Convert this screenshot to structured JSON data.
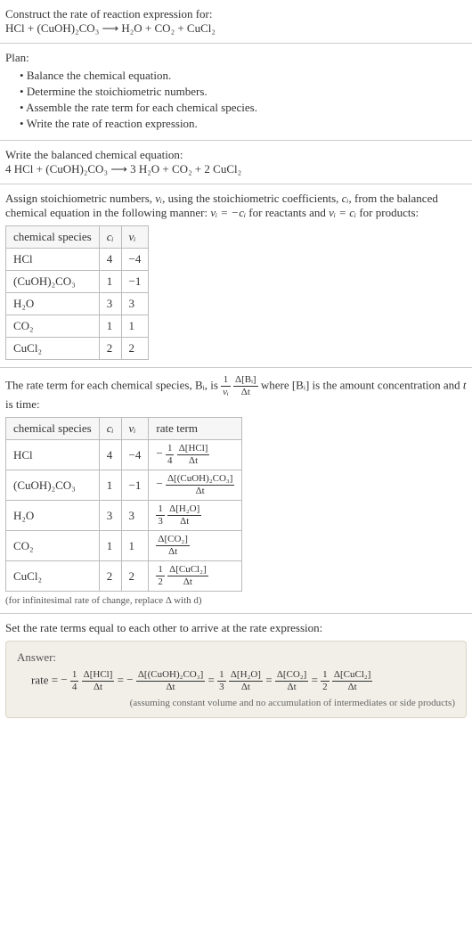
{
  "prompt": {
    "title": "Construct the rate of reaction expression for:",
    "equation": "HCl + (CuOH)₂CO₃  ⟶  H₂O + CO₂ + CuCl₂"
  },
  "plan": {
    "title": "Plan:",
    "items": [
      "Balance the chemical equation.",
      "Determine the stoichiometric numbers.",
      "Assemble the rate term for each chemical species.",
      "Write the rate of reaction expression."
    ]
  },
  "balanced": {
    "title": "Write the balanced chemical equation:",
    "equation": "4 HCl + (CuOH)₂CO₃  ⟶  3 H₂O + CO₂ + 2 CuCl₂"
  },
  "assign": {
    "text_a": "Assign stoichiometric numbers, ",
    "nu": "νᵢ",
    "text_b": ", using the stoichiometric coefficients, ",
    "ci": "cᵢ",
    "text_c": ", from the balanced chemical equation in the following manner: ",
    "rel1": "νᵢ = −cᵢ",
    "text_d": " for reactants and ",
    "rel2": "νᵢ = cᵢ",
    "text_e": " for products:",
    "headers": {
      "species": "chemical species",
      "ci": "cᵢ",
      "nu": "νᵢ"
    },
    "rows": [
      {
        "species": "HCl",
        "ci": "4",
        "nu": "−4"
      },
      {
        "species": "(CuOH)₂CO₃",
        "ci": "1",
        "nu": "−1"
      },
      {
        "species": "H₂O",
        "ci": "3",
        "nu": "3"
      },
      {
        "species": "CO₂",
        "ci": "1",
        "nu": "1"
      },
      {
        "species": "CuCl₂",
        "ci": "2",
        "nu": "2"
      }
    ]
  },
  "rateterm": {
    "text_a": "The rate term for each chemical species, Bᵢ, is ",
    "text_b": " where [Bᵢ] is the amount concentration and ",
    "tvar": "t",
    "text_c": " is time:",
    "main_frac_outer_num": "1",
    "main_frac_outer_den": "νᵢ",
    "main_frac_inner_num": "Δ[Bᵢ]",
    "main_frac_inner_den": "Δt",
    "headers": {
      "species": "chemical species",
      "ci": "cᵢ",
      "nu": "νᵢ",
      "rate": "rate term"
    },
    "rows": [
      {
        "species": "HCl",
        "ci": "4",
        "nu": "−4",
        "pre": "−",
        "lead_num": "1",
        "lead_den": "4",
        "num": "Δ[HCl]",
        "den": "Δt"
      },
      {
        "species": "(CuOH)₂CO₃",
        "ci": "1",
        "nu": "−1",
        "pre": "−",
        "lead_num": "",
        "lead_den": "",
        "num": "Δ[(CuOH)₂CO₃]",
        "den": "Δt"
      },
      {
        "species": "H₂O",
        "ci": "3",
        "nu": "3",
        "pre": "",
        "lead_num": "1",
        "lead_den": "3",
        "num": "Δ[H₂O]",
        "den": "Δt"
      },
      {
        "species": "CO₂",
        "ci": "1",
        "nu": "1",
        "pre": "",
        "lead_num": "",
        "lead_den": "",
        "num": "Δ[CO₂]",
        "den": "Δt"
      },
      {
        "species": "CuCl₂",
        "ci": "2",
        "nu": "2",
        "pre": "",
        "lead_num": "1",
        "lead_den": "2",
        "num": "Δ[CuCl₂]",
        "den": "Δt"
      }
    ],
    "footnote": "(for infinitesimal rate of change, replace Δ with d)"
  },
  "final": {
    "title": "Set the rate terms equal to each other to arrive at the rate expression:",
    "answer_label": "Answer:",
    "rate_label": "rate = ",
    "terms": [
      {
        "pre": "−",
        "lead_num": "1",
        "lead_den": "4",
        "num": "Δ[HCl]",
        "den": "Δt"
      },
      {
        "pre": "−",
        "lead_num": "",
        "lead_den": "",
        "num": "Δ[(CuOH)₂CO₃]",
        "den": "Δt"
      },
      {
        "pre": "",
        "lead_num": "1",
        "lead_den": "3",
        "num": "Δ[H₂O]",
        "den": "Δt"
      },
      {
        "pre": "",
        "lead_num": "",
        "lead_den": "",
        "num": "Δ[CO₂]",
        "den": "Δt"
      },
      {
        "pre": "",
        "lead_num": "1",
        "lead_den": "2",
        "num": "Δ[CuCl₂]",
        "den": "Δt"
      }
    ],
    "note": "(assuming constant volume and no accumulation of intermediates or side products)"
  },
  "chart_data": {
    "type": "table",
    "title": "Stoichiometric numbers and rate terms",
    "tables": [
      {
        "columns": [
          "chemical species",
          "cᵢ",
          "νᵢ"
        ],
        "rows": [
          [
            "HCl",
            4,
            -4
          ],
          [
            "(CuOH)₂CO₃",
            1,
            -1
          ],
          [
            "H₂O",
            3,
            3
          ],
          [
            "CO₂",
            1,
            1
          ],
          [
            "CuCl₂",
            2,
            2
          ]
        ]
      },
      {
        "columns": [
          "chemical species",
          "cᵢ",
          "νᵢ",
          "rate term"
        ],
        "rows": [
          [
            "HCl",
            4,
            -4,
            "−(1/4) Δ[HCl]/Δt"
          ],
          [
            "(CuOH)₂CO₃",
            1,
            -1,
            "− Δ[(CuOH)₂CO₃]/Δt"
          ],
          [
            "H₂O",
            3,
            3,
            "(1/3) Δ[H₂O]/Δt"
          ],
          [
            "CO₂",
            1,
            1,
            "Δ[CO₂]/Δt"
          ],
          [
            "CuCl₂",
            2,
            2,
            "(1/2) Δ[CuCl₂]/Δt"
          ]
        ]
      }
    ],
    "balanced_equation": "4 HCl + (CuOH)2CO3 ⟶ 3 H2O + CO2 + 2 CuCl2",
    "rate_expression": "rate = −(1/4) Δ[HCl]/Δt = − Δ[(CuOH)2CO3]/Δt = (1/3) Δ[H2O]/Δt = Δ[CO2]/Δt = (1/2) Δ[CuCl2]/Δt"
  }
}
